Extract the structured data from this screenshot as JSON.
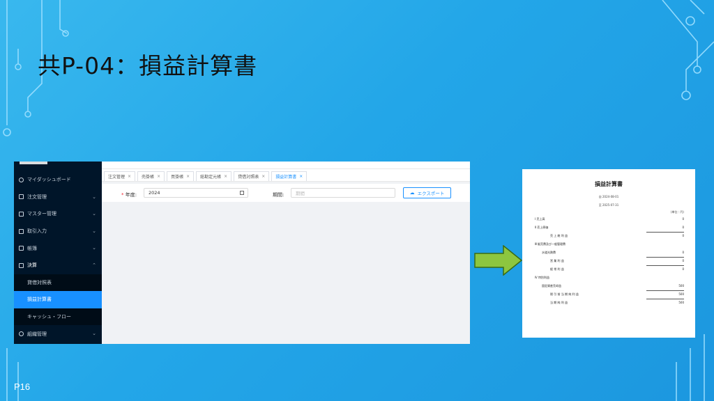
{
  "slide": {
    "title": "共P-04：損益計算書",
    "page_number": "P16"
  },
  "app": {
    "sidebar": {
      "items": [
        {
          "label": "マイダッシュボード",
          "icon": "dashboard-icon",
          "chevron": ""
        },
        {
          "label": "注文管理",
          "icon": "document-icon",
          "chevron": "⌄"
        },
        {
          "label": "マスター管理",
          "icon": "list-icon",
          "chevron": "⌄"
        },
        {
          "label": "取引入力",
          "icon": "edit-icon",
          "chevron": "⌄"
        },
        {
          "label": "帳簿",
          "icon": "book-icon",
          "chevron": "⌄"
        },
        {
          "label": "決算",
          "icon": "calculator-icon",
          "chevron": "⌃"
        }
      ],
      "sub_items": [
        {
          "label": "貸借対照表"
        },
        {
          "label": "損益計算書"
        },
        {
          "label": "キャッシュ・フロー"
        }
      ],
      "last_item": {
        "label": "組織管理",
        "icon": "team-icon",
        "chevron": "⌄"
      }
    },
    "tabs": [
      {
        "label": "注文管理"
      },
      {
        "label": "売掛帳"
      },
      {
        "label": "買掛帳"
      },
      {
        "label": "総勘定元帳"
      },
      {
        "label": "貸借対照表"
      },
      {
        "label": "損益計算書"
      }
    ],
    "active_tab_index": 5,
    "form": {
      "year_required": "*",
      "year_label": "年度:",
      "year_value": "2024",
      "period_label": "期間:",
      "period_placeholder": "期間",
      "export_label": "エクスポート"
    },
    "colors": {
      "primary": "#1890ff",
      "sidebar_bg": "#001529"
    }
  },
  "report": {
    "title": "損益計算書",
    "from": "自 2024-08-01",
    "to": "至 2025-07-31",
    "unit": "(単位：円)",
    "rows": [
      {
        "label": "Ⅰ 売上高",
        "amount": "0"
      },
      {
        "label": "Ⅱ 売上原価",
        "amount": "0"
      },
      {
        "label": "売 上 総 利 益",
        "amount": "0"
      },
      {
        "label": "Ⅲ 販売費及び一般管理費",
        "amount": ""
      },
      {
        "label": "水道光熱費",
        "amount": "0"
      },
      {
        "label": "営 業 利 益",
        "amount": "0"
      },
      {
        "label": "経 常 利 益",
        "amount": "0"
      },
      {
        "label": "Ⅳ 特別利益",
        "amount": ""
      },
      {
        "label": "固定資産売却益",
        "amount": "500"
      },
      {
        "label": "税 引 前 当 期 純 利 益",
        "amount": "500"
      },
      {
        "label": "当 期 純 利 益",
        "amount": "500"
      }
    ]
  }
}
